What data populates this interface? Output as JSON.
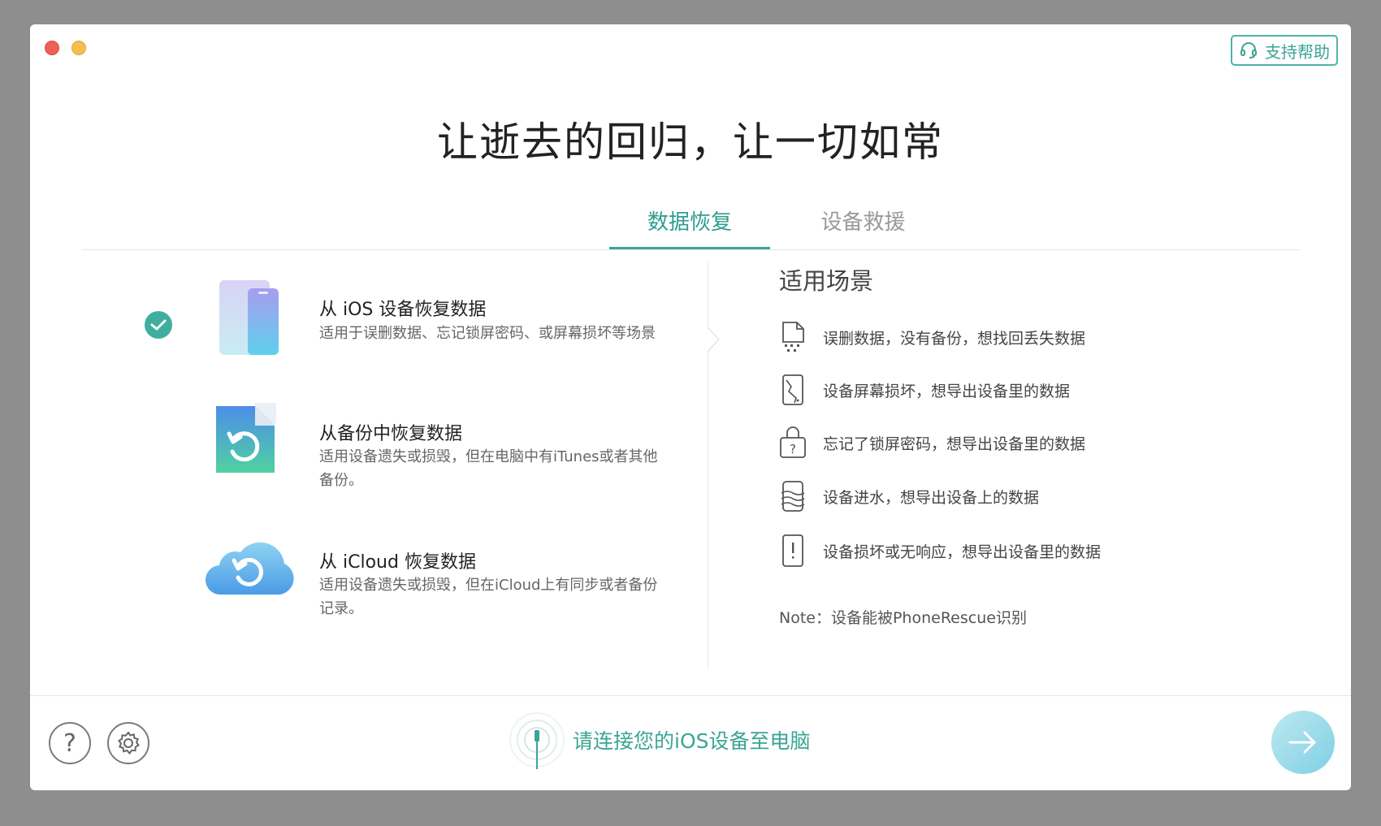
{
  "support": {
    "label": "支持帮助"
  },
  "hero": {
    "title": "让逝去的回归，让一切如常"
  },
  "tabs": [
    {
      "label": "数据恢复",
      "active": true
    },
    {
      "label": "设备救援",
      "active": false
    }
  ],
  "options": [
    {
      "title": "从 iOS 设备恢复数据",
      "desc": "适用于误删数据、忘记锁屏密码、或屏幕损坏等场景",
      "selected": true
    },
    {
      "title": "从备份中恢复数据",
      "desc": "适用设备遗失或损毁，但在电脑中有iTunes或者其他备份。",
      "selected": false
    },
    {
      "title": "从 iCloud 恢复数据",
      "desc": "适用设备遗失或损毁，但在iCloud上有同步或者备份记录。",
      "selected": false
    }
  ],
  "scenarios": {
    "title": "适用场景",
    "items": [
      {
        "icon": "deleted-file-icon",
        "text": "误删数据，没有备份，想找回丢失数据"
      },
      {
        "icon": "broken-screen-icon",
        "text": "设备屏幕损坏，想导出设备里的数据"
      },
      {
        "icon": "locked-device-icon",
        "text": "忘记了锁屏密码，想导出设备里的数据"
      },
      {
        "icon": "water-damage-icon",
        "text": "设备进水，想导出设备上的数据"
      },
      {
        "icon": "unresponsive-device-icon",
        "text": "设备损坏或无响应，想导出设备里的数据"
      }
    ],
    "note": "Note：设备能被PhoneRescue识别"
  },
  "bottom": {
    "connect_text": "请连接您的iOS设备至电脑"
  },
  "colors": {
    "accent": "#3aa596",
    "check": "#3fae9f",
    "next": "#7dd0e5"
  }
}
